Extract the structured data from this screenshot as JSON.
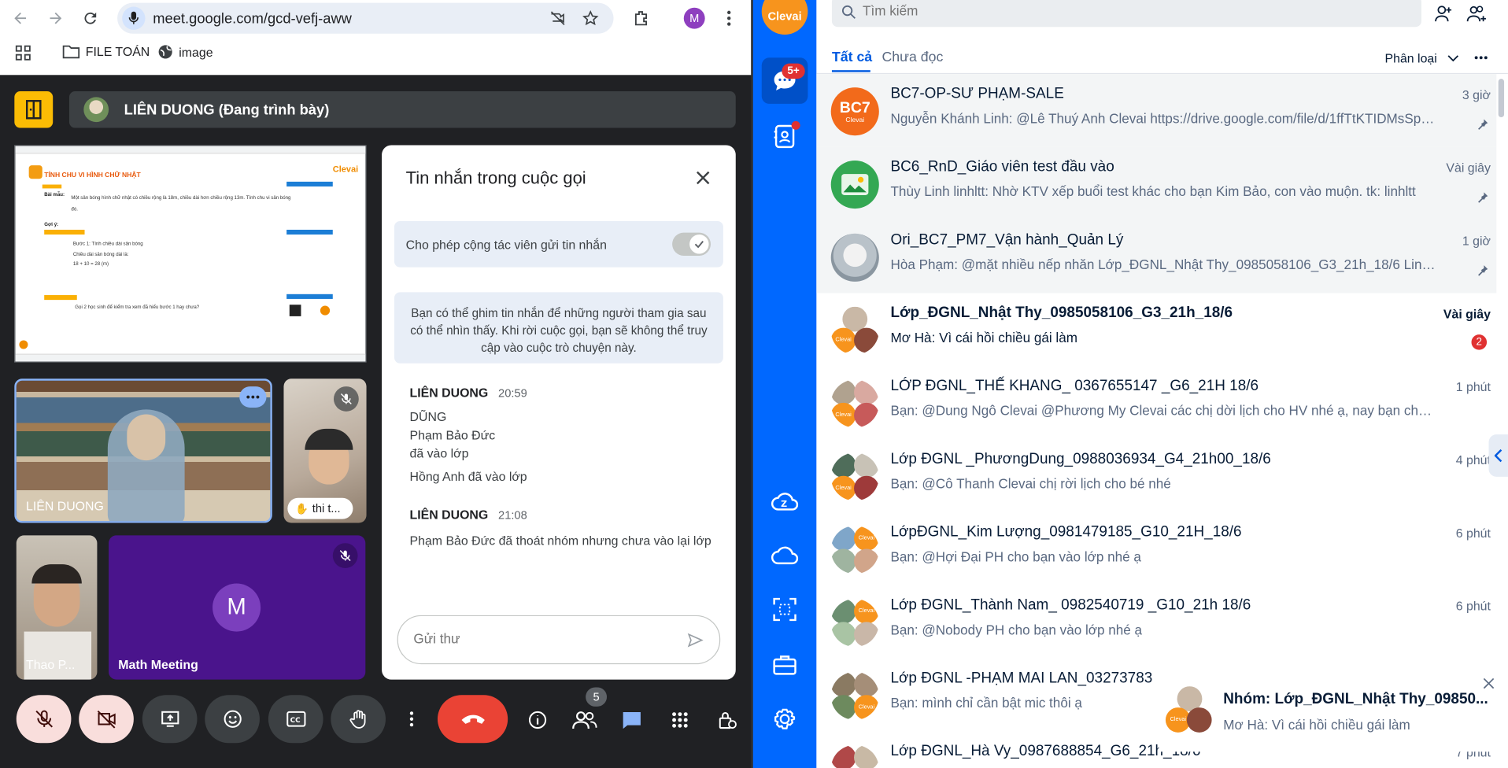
{
  "browser": {
    "url": "meet.google.com/gcd-vefj-aww",
    "profile_initial": "M",
    "bookmarks": [
      "FILE TOÁN",
      "image"
    ]
  },
  "meet": {
    "presenter_label": "LIÊN DUONG (Đang trình bày)",
    "slide": {
      "title": "TÍNH CHU VI HÌNH CHỮ NHẬT",
      "logo": "Clevai",
      "example_label": "Bài mẫu:",
      "example_text": "Một sân bóng hình chữ nhật có chiều rộng là 18m, chiều dài hơn chiều rộng 13m. Tính chu vi sân bóng đó.",
      "hint_label": "Gợi ý:",
      "step1": "Bước 1: Tính chiều dài sân bóng",
      "step1b": "Chiều dài sân bóng dài là:",
      "step1c": "18 + 10 = 28 (m)",
      "question": "Gọi 2 học sinh để kiểm tra xem đã hiểu bước 1 hay chưa?"
    },
    "tiles": [
      {
        "name": "LIÊN DUONG"
      },
      {
        "name": "thi t..."
      },
      {
        "name": "Thao P..."
      },
      {
        "name": "Math Meeting",
        "initial": "M"
      }
    ],
    "participant_count": "5",
    "chat": {
      "title": "Tin nhắn trong cuộc gọi",
      "toggle_label": "Cho phép cộng tác viên gửi tin nhắn",
      "toggle_on": true,
      "info": "Bạn có thể ghim tin nhắn để những người tham gia sau có thể nhìn thấy. Khi rời cuộc gọi, bạn sẽ không thể truy cập vào cuộc trò chuyện này.",
      "messages": [
        {
          "sender": "LIÊN DUONG",
          "time": "20:59",
          "lines": [
            "DŨNG",
            "Phạm Bảo Đức",
            "đã vào lớp",
            "Hồng Anh đã vào lớp"
          ]
        },
        {
          "sender": "LIÊN DUONG",
          "time": "21:08",
          "lines": [
            "Phạm Bảo Đức đã thoát nhóm nhưng chưa vào lại lớp"
          ]
        }
      ],
      "input_placeholder": "Gửi thư"
    }
  },
  "zalo": {
    "brand": "Clevai",
    "badge_messages": "5+",
    "search_placeholder": "Tìm kiếm",
    "tabs": [
      "Tất cả",
      "Chưa đọc"
    ],
    "sort_label": "Phân loại",
    "conversations": [
      {
        "title": "BC7-OP-SƯ PHẠM-SALE",
        "message": "Nguyễn Khánh Linh: @Lê Thuý Anh Clevai https://drive.google.com/file/d/1ffTtKTIDMsSpBl...",
        "time": "3 giờ",
        "pinned": true,
        "avatar": "BC7"
      },
      {
        "title": "BC6_RnD_Giáo viên test đầu vào",
        "message": "Thùy Linh linhltt: Nhờ KTV xếp buổi test khác cho bạn Kim Bảo, con vào muộn. tk: linhltt",
        "time": "Vài giây",
        "pinned": true
      },
      {
        "title": "Ori_BC7_PM7_Vận hành_Quản Lý",
        "message": "Hòa Phạm: @mặt nhiều nếp nhăn Lớp_ĐGNL_Nhật Thy_0985058106_G3_21h_18/6 Link : http...",
        "time": "1 giờ",
        "pinned": true
      },
      {
        "title": "Lớp_ĐGNL_Nhật Thy_0985058106_G3_21h_18/6",
        "message": "Mơ Hà: Vì cái hồi chiều gái làm",
        "time": "Vài giây",
        "unread": "2"
      },
      {
        "title": "LỚP ĐGNL_THẾ KHANG_ 0367655147 _G6_21H 18/6",
        "message": "Bạn: @Dung Ngô Clevai @Phương My Clevai các chị dời lịch cho HV nhé ạ, nay bạn chưa tham ...",
        "time": "1 phút"
      },
      {
        "title": "Lớp ĐGNL _PhươngDung_0988036934_G4_21h00_18/6",
        "message": "Bạn: @Cô Thanh Clevai chị rời lịch cho bé nhé",
        "time": "4 phút"
      },
      {
        "title": "LớpĐGNL_Kim Lượng_0981479185_G10_21H_18/6",
        "message": "Bạn: @Hợi Đại PH cho bạn vào lớp nhé ạ",
        "time": "6 phút"
      },
      {
        "title": "Lớp ĐGNL_Thành Nam_ 0982540719 _G10_21h 18/6",
        "message": "Bạn: @Nobody PH cho bạn vào lớp nhé ạ",
        "time": "6 phút"
      },
      {
        "title": "Lớp ĐGNL -PHẠM MAI LAN_03273783",
        "message": "Bạn: mình chỉ cần bật mic thôi ạ",
        "time": ""
      },
      {
        "title": "Lớp ĐGNL_Hà Vy_0987688854_G6_21h_18/6",
        "message": "",
        "time": "7 phút"
      }
    ],
    "toast": {
      "title": "Nhóm: Lớp_ĐGNL_Nhật Thy_09850...",
      "message": "Mơ Hà: Vì cái hồi chiều gái làm"
    }
  }
}
